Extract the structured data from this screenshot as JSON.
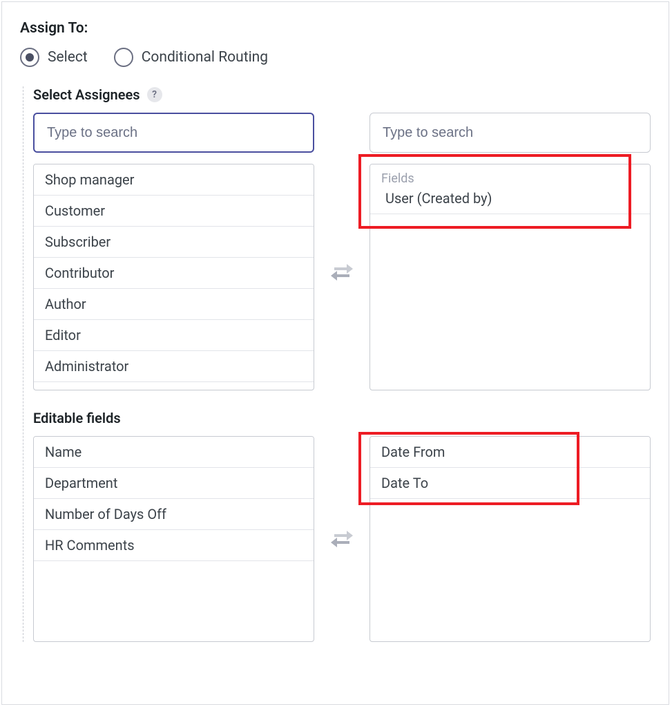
{
  "header": {
    "title": "Assign To:"
  },
  "radios": {
    "select": "Select",
    "conditional": "Conditional Routing"
  },
  "assignees": {
    "title": "Select Assignees",
    "help": "?",
    "left_placeholder": "Type to search",
    "right_placeholder": "Type to search",
    "left_items": [
      "Shop manager",
      "Customer",
      "Subscriber",
      "Contributor",
      "Author",
      "Editor",
      "Administrator"
    ],
    "right_group_label": "Fields",
    "right_group_item": "User (Created by)"
  },
  "editable": {
    "title": "Editable fields",
    "left_items": [
      "Name",
      "Department",
      "Number of Days Off",
      "HR Comments"
    ],
    "right_items": [
      "Date From",
      "Date To"
    ]
  }
}
